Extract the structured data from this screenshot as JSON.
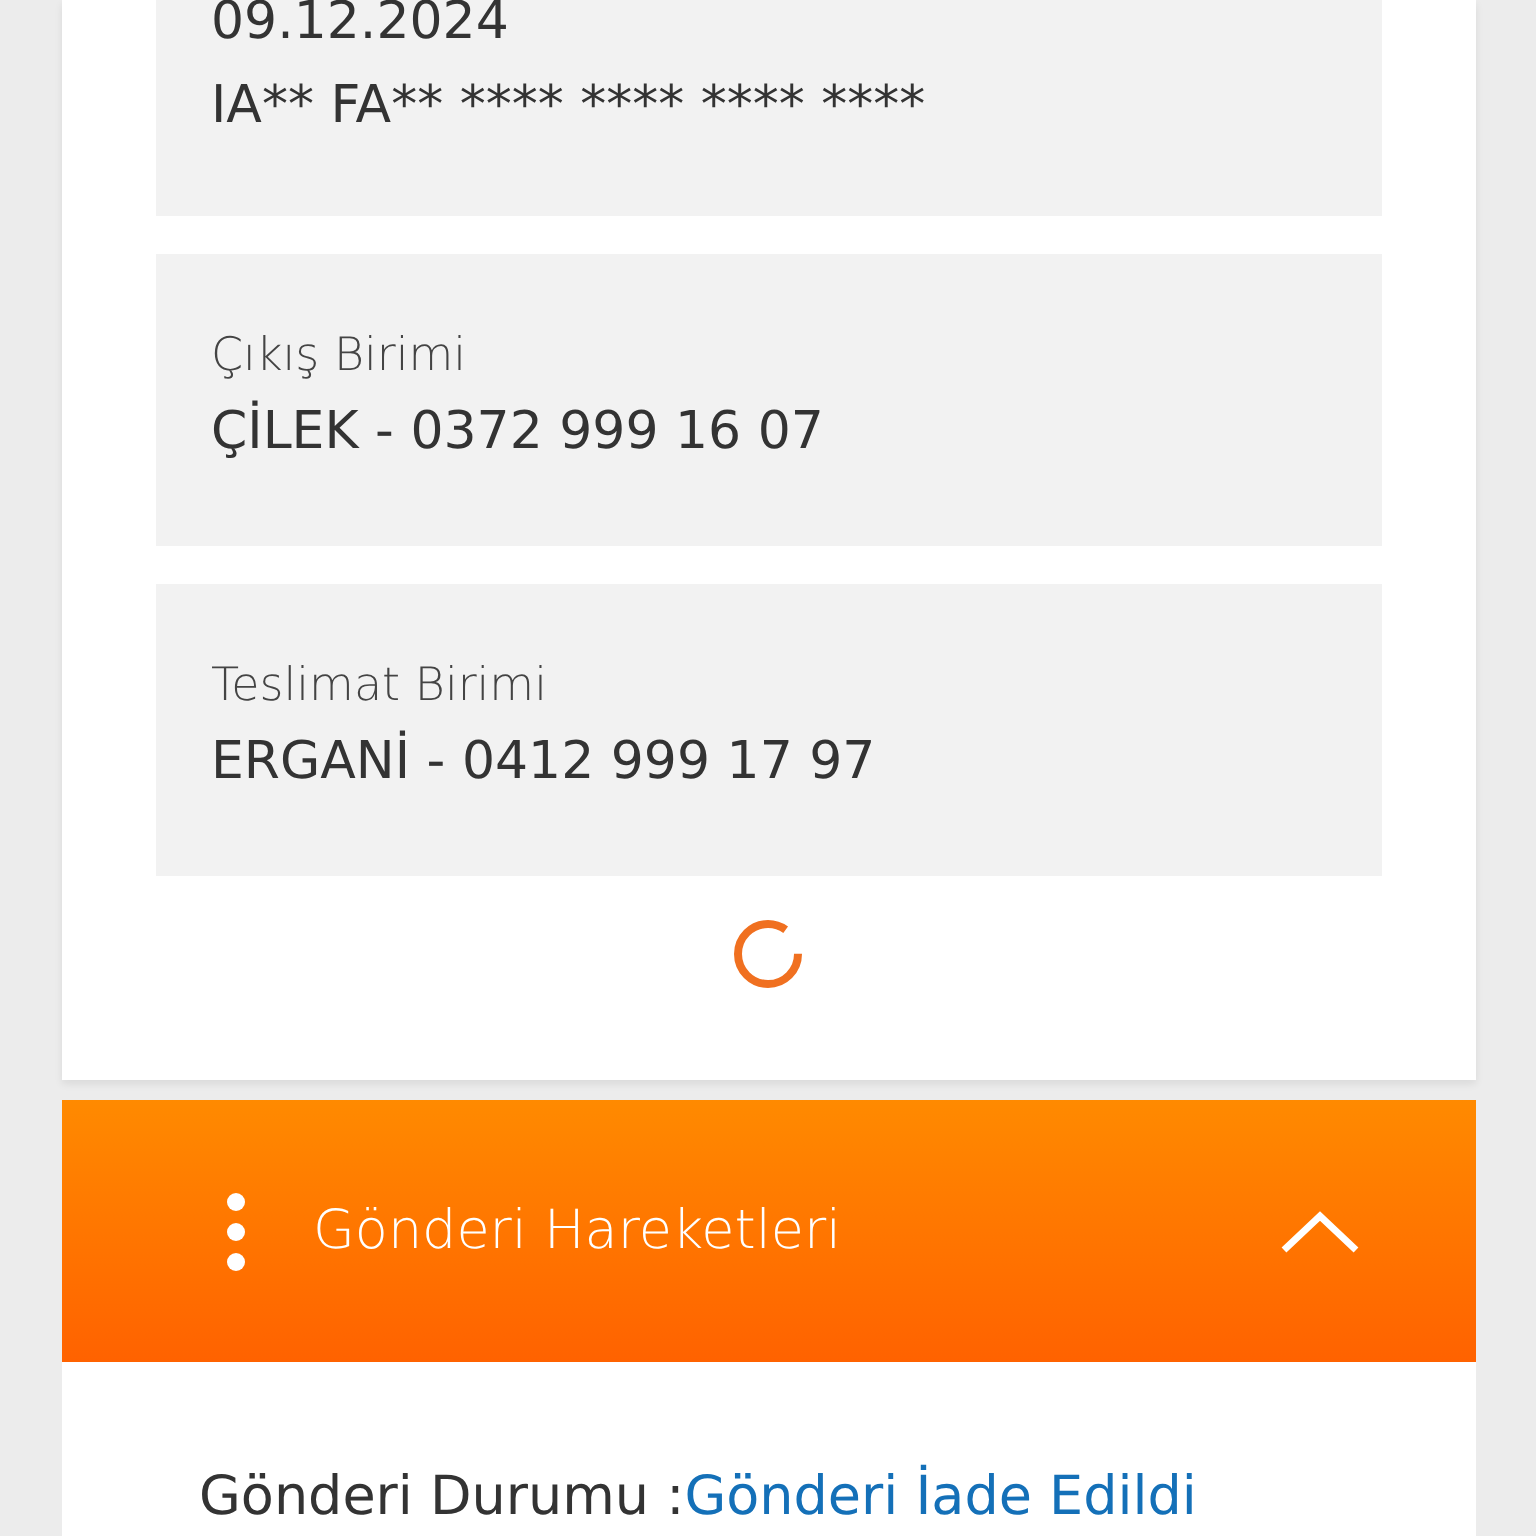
{
  "info_boxes": [
    {
      "lines": [
        "09.12.2024",
        "IA** FA** **** **** **** ****"
      ]
    },
    {
      "label": "Çıkış Birimi",
      "lines": [
        "ÇİLEK - 0372 999 16 07"
      ]
    },
    {
      "label": "Teslimat Birimi",
      "lines": [
        "ERGANİ - 0412 999 17 97"
      ]
    }
  ],
  "section": {
    "title": "Gönderi Hareketleri",
    "expanded": true
  },
  "status": {
    "label": "Gönderi Durumu :",
    "value": "Gönderi İade Edildi"
  }
}
